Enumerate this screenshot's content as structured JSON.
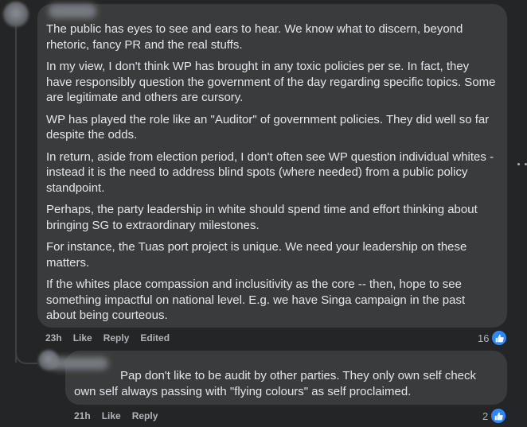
{
  "comment": {
    "paragraphs": [
      "The public has eyes to see and ears to hear. We know what to discern, beyond rhetoric, fancy PR and the real stuffs.",
      "In my view, I don't think WP has brought in any toxic policies per se. In fact, they have responsibly question the government of the day regarding specific topics. Some are legitimate and others are cursory.",
      "WP has played the role like an \"Auditor\" of government policies. They did well so far despite the odds.",
      "In return, aside from election period, I don't often see WP question individual whites - instead it is the need to address blind spots (where needed) from a public policy standpoint.",
      "Perhaps, the party leadership in white should spend time and effort thinking about bringing SG to extraordinary milestones.",
      "For instance, the Tuas port project is unique. We need your leadership on these matters.",
      "If the whites place compassion and inclusitivity as the core -- then, hope to see something impactful on national level. E.g. we have Singa campaign in the past about being courteous."
    ],
    "time": "23h",
    "like_label": "Like",
    "reply_label": "Reply",
    "edited_label": "Edited",
    "reaction_count": "16"
  },
  "reply": {
    "text": "Pap don't like to be audit by other parties. They only own self check own self always passing with \"flying colours\" as self proclaimed.",
    "time": "21h",
    "like_label": "Like",
    "reply_label": "Reply",
    "reaction_count": "2"
  },
  "colors": {
    "background": "#242526",
    "bubble": "#3a3b3c",
    "text": "#e4e6eb",
    "secondary_text": "#b0b3b8",
    "like_blue": "#2d88ff"
  },
  "icons": [
    "like-thumb-icon",
    "more-options-icon"
  ]
}
